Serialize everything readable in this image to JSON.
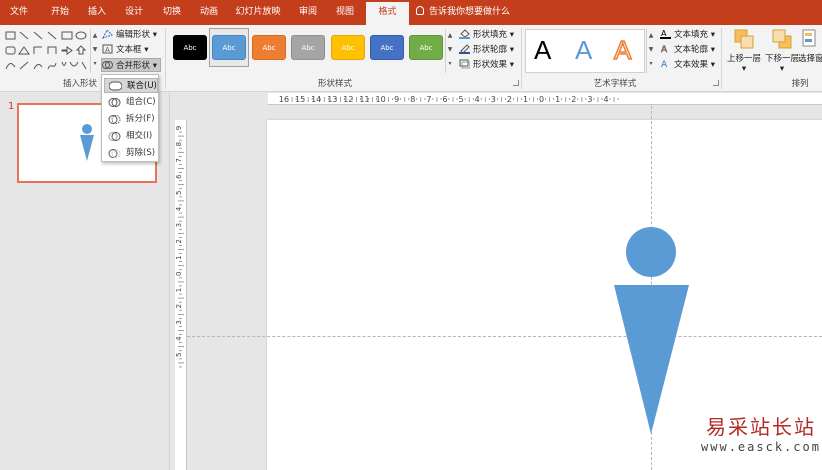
{
  "tabs": [
    {
      "label": "文件"
    },
    {
      "label": "开始"
    },
    {
      "label": "插入"
    },
    {
      "label": "设计"
    },
    {
      "label": "切换"
    },
    {
      "label": "动画"
    },
    {
      "label": "幻灯片放映"
    },
    {
      "label": "审阅"
    },
    {
      "label": "视图"
    },
    {
      "label": "格式"
    }
  ],
  "tell_me": "告诉我你想要做什么",
  "insert_shapes": {
    "label": "插入形状",
    "edit_shape": "编辑形状",
    "text_box": "文本框",
    "merge_shapes": "合并形状"
  },
  "shape_styles": {
    "label": "形状样式",
    "preset_text": "Abc",
    "presets": [
      {
        "fill": "#000000",
        "border": "#000000"
      },
      {
        "fill": "#5b9bd5",
        "border": "#4a86bd"
      },
      {
        "fill": "#ed7d31",
        "border": "#d66a20"
      },
      {
        "fill": "#a5a5a5",
        "border": "#8f8f8f"
      },
      {
        "fill": "#ffc000",
        "border": "#e0a800"
      },
      {
        "fill": "#4472c4",
        "border": "#365ea8"
      },
      {
        "fill": "#70ad47",
        "border": "#5d963a"
      }
    ],
    "fill": "形状填充",
    "outline": "形状轮廓",
    "effects": "形状效果"
  },
  "wordart": {
    "label": "艺术字样式",
    "sample": "A",
    "text_fill": "文本填充",
    "text_outline": "文本轮廓",
    "text_effects": "文本效果"
  },
  "arrange": {
    "label": "排列",
    "bring_forward": "上移一层",
    "send_backward": "下移一层",
    "selection_pane": "选择窗"
  },
  "merge_menu": [
    {
      "label": "联合(U)",
      "icon": "union-icon"
    },
    {
      "label": "组合(C)",
      "icon": "combine-icon"
    },
    {
      "label": "拆分(F)",
      "icon": "fragment-icon"
    },
    {
      "label": "相交(I)",
      "icon": "intersect-icon"
    },
    {
      "label": "剪除(S)",
      "icon": "subtract-icon"
    }
  ],
  "slide_number": "1",
  "ruler": {
    "h_ticks": [
      "16",
      "15",
      "14",
      "13",
      "12",
      "11",
      "10",
      "9",
      "8",
      "7",
      "6",
      "5",
      "4",
      "3",
      "2",
      "1",
      "0",
      "1",
      "2",
      "3",
      "4"
    ],
    "v_ticks": [
      "9",
      "8",
      "7",
      "6",
      "5",
      "4",
      "3",
      "2",
      "1",
      "0",
      "1",
      "2",
      "3",
      "4",
      "5"
    ]
  },
  "shape_color": "#5b9bd5",
  "accent": "#c43e1c",
  "watermark": {
    "cn": "易采站长站",
    "en": "www.easck.com"
  }
}
